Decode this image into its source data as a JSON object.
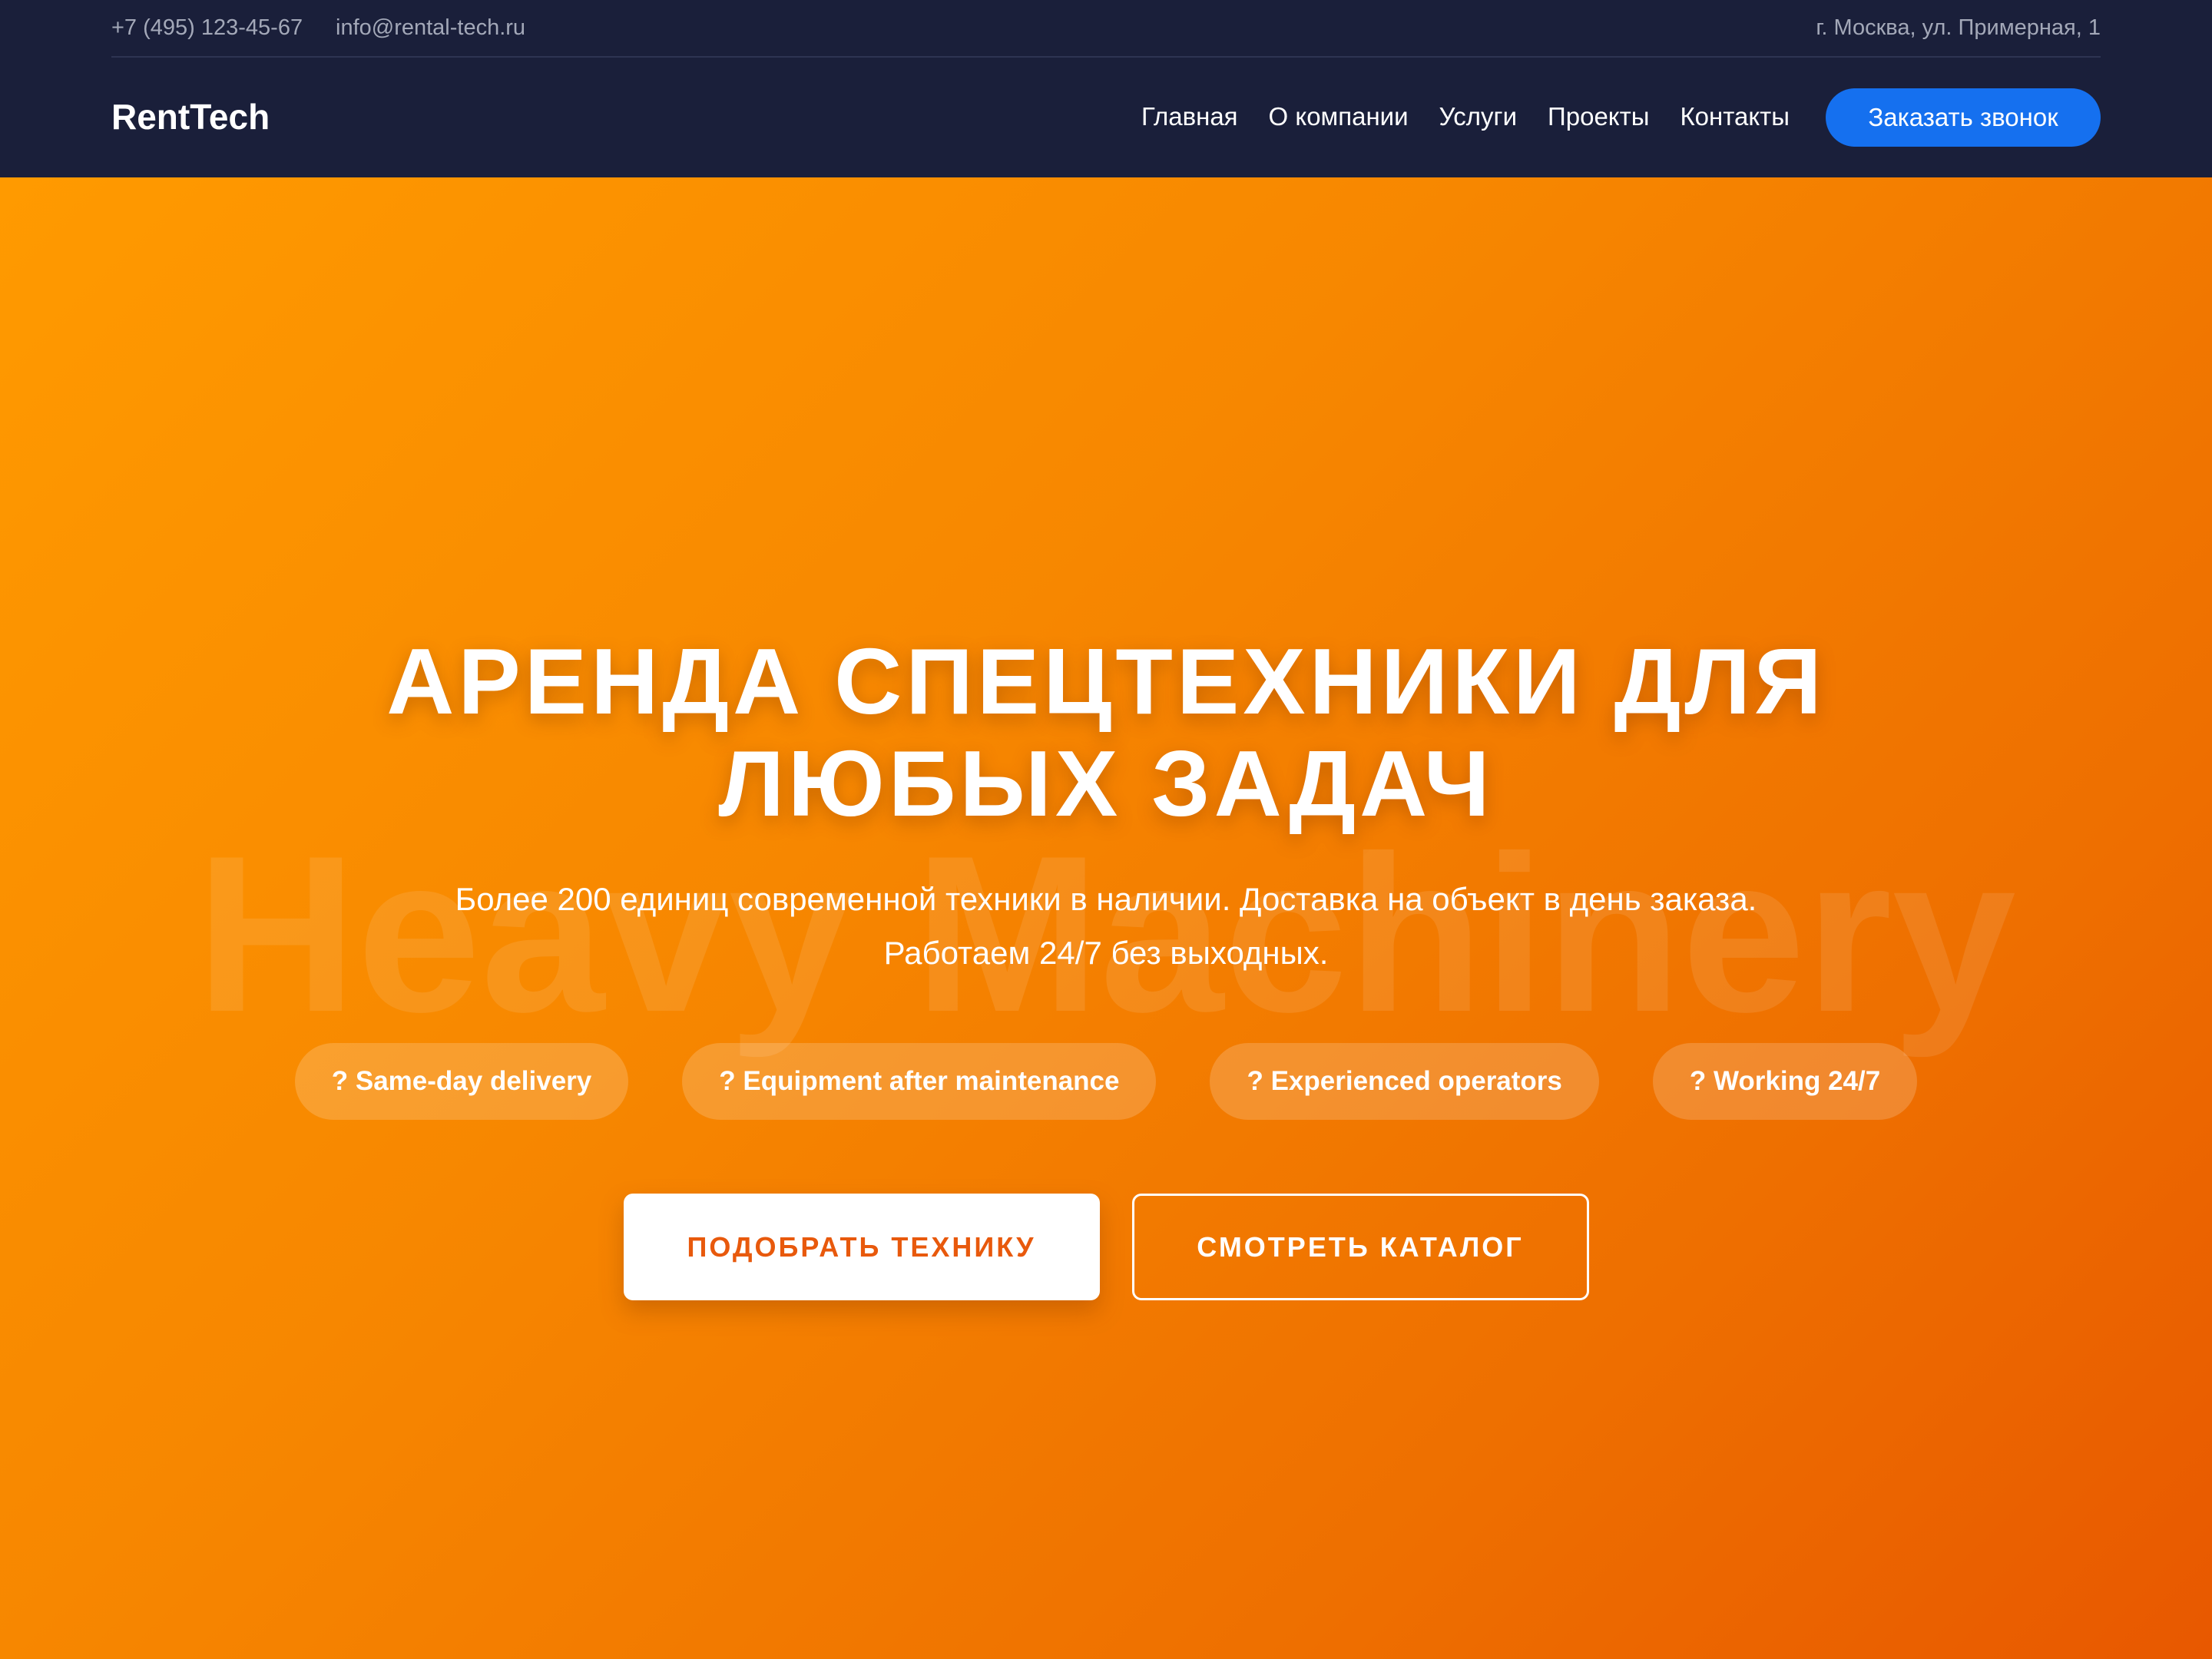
{
  "topbar": {
    "phone": "+7 (495) 123-45-67",
    "email": "info@rental-tech.ru",
    "address": "г. Москва, ул. Примерная, 1"
  },
  "nav": {
    "logo": "RentTech",
    "links": [
      "Главная",
      "О компании",
      "Услуги",
      "Проекты",
      "Контакты"
    ],
    "callback_label": "Заказать звонок"
  },
  "hero": {
    "watermark": "Heavy Machinery",
    "title_line1": "АРЕНДА СПЕЦТЕХНИКИ ДЛЯ",
    "title_line2": "ЛЮБЫХ ЗАДАЧ",
    "subtitle": "Более 200 единиц современной техники в наличии. Доставка на объект в день заказа. Работаем 24/7 без выходных.",
    "features": [
      "? Same-day delivery",
      "? Equipment after maintenance",
      "? Experienced operators",
      "? Working 24/7"
    ],
    "cta_primary": "ПОДОБРАТЬ ТЕХНИКУ",
    "cta_secondary": "СМОТРЕТЬ КАТАЛОГ"
  },
  "colors": {
    "header_bg": "#1a1f3a",
    "accent_blue": "#1570ef",
    "hero_orange_start": "#ff9a00",
    "hero_orange_end": "#e85800",
    "cta_text": "#e8590c"
  }
}
